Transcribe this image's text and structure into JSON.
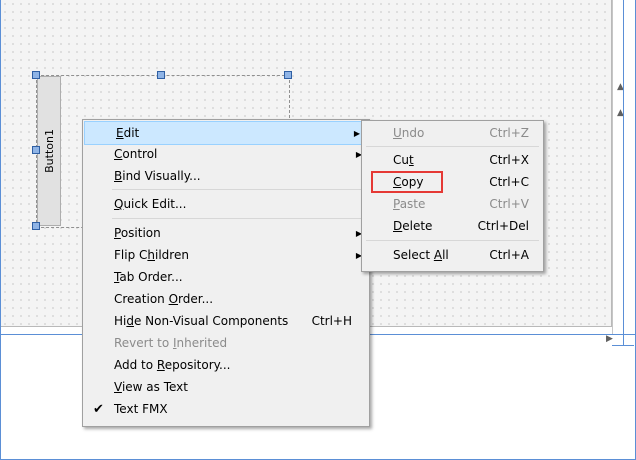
{
  "designer": {
    "button1_label": "Button1"
  },
  "context_menu": {
    "items": [
      {
        "pre": "",
        "ul": "E",
        "post": "dit",
        "shortcut": "",
        "submenu": true
      },
      {
        "pre": "",
        "ul": "C",
        "post": "ontrol",
        "shortcut": "",
        "submenu": true
      },
      {
        "pre": "",
        "ul": "B",
        "post": "ind Visually...",
        "shortcut": ""
      },
      {
        "pre": "",
        "ul": "Q",
        "post": "uick Edit...",
        "shortcut": ""
      },
      {
        "pre": "",
        "ul": "P",
        "post": "osition",
        "shortcut": "",
        "submenu": true
      },
      {
        "pre": "Flip C",
        "ul": "h",
        "post": "ildren",
        "shortcut": "",
        "submenu": true
      },
      {
        "pre": "",
        "ul": "T",
        "post": "ab Order...",
        "shortcut": ""
      },
      {
        "pre": "Creation ",
        "ul": "O",
        "post": "rder...",
        "shortcut": ""
      },
      {
        "pre": "Hi",
        "ul": "d",
        "post": "e Non-Visual Components",
        "shortcut": "Ctrl+H"
      },
      {
        "pre": "Revert to ",
        "ul": "I",
        "post": "nherited",
        "shortcut": "",
        "disabled": true
      },
      {
        "pre": "Add to ",
        "ul": "R",
        "post": "epository...",
        "shortcut": ""
      },
      {
        "pre": "",
        "ul": "V",
        "post": "iew as Text",
        "shortcut": ""
      },
      {
        "pre": "",
        "ul": "",
        "post": "Text FMX",
        "shortcut": "",
        "checked": true
      }
    ]
  },
  "edit_submenu": {
    "items": [
      {
        "pre": "",
        "ul": "U",
        "post": "ndo",
        "shortcut": "Ctrl+Z",
        "disabled": true
      },
      {
        "pre": "Cu",
        "ul": "t",
        "post": "",
        "shortcut": "Ctrl+X"
      },
      {
        "pre": "",
        "ul": "C",
        "post": "opy",
        "shortcut": "Ctrl+C"
      },
      {
        "pre": "",
        "ul": "P",
        "post": "aste",
        "shortcut": "Ctrl+V",
        "disabled": true
      },
      {
        "pre": "",
        "ul": "D",
        "post": "elete",
        "shortcut": "Ctrl+Del"
      },
      {
        "pre": "Select ",
        "ul": "A",
        "post": "ll",
        "shortcut": "Ctrl+A"
      }
    ]
  },
  "colors": {
    "highlight": "#cce8ff",
    "annotation": "#e53935"
  }
}
